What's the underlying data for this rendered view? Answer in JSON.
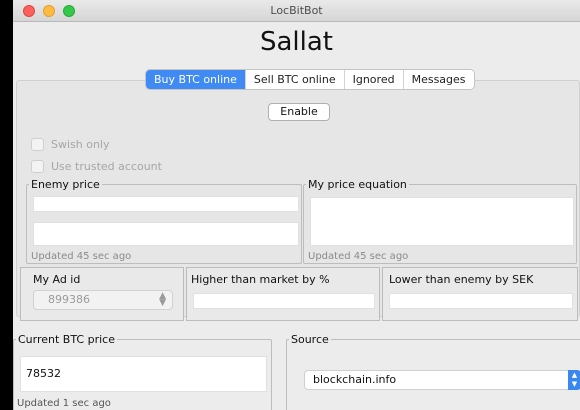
{
  "window": {
    "title": "LocBitBot"
  },
  "app": {
    "name": "Sallat"
  },
  "tabs": [
    {
      "label": "Buy BTC online",
      "active": true
    },
    {
      "label": "Sell BTC online",
      "active": false
    },
    {
      "label": "Ignored",
      "active": false
    },
    {
      "label": "Messages",
      "active": false
    }
  ],
  "buy_tab": {
    "enable_label": "Enable",
    "swish_only_label": "Swish only",
    "use_trusted_account_label": "Use trusted account",
    "enemy_price": {
      "legend": "Enemy price",
      "field1_value": "",
      "field2_value": "",
      "updated": "Updated 45 sec ago"
    },
    "my_price_equation": {
      "legend": "My price equation",
      "value": "",
      "updated": "Updated 45 sec ago"
    },
    "my_ad_id": {
      "label": "My Ad id",
      "value": "899386"
    },
    "higher_than_market": {
      "label": "Higher than market by %",
      "value": ""
    },
    "lower_than_enemy": {
      "label": "Lower than enemy by SEK",
      "value": ""
    }
  },
  "current_btc_price": {
    "legend": "Current BTC price",
    "value": "78532",
    "updated": "Updated 1 sec ago"
  },
  "source": {
    "legend": "Source",
    "selected": "blockchain.info"
  },
  "colors": {
    "accent": "#3f8bf3",
    "close": "#fc605c",
    "minimize": "#fdbc40",
    "maximize": "#34c84a"
  }
}
